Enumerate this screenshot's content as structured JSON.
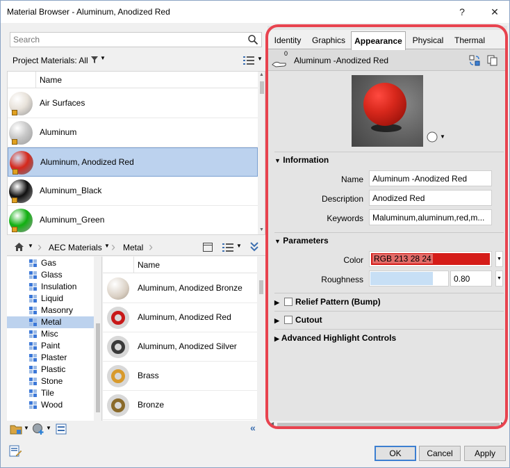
{
  "window": {
    "title": "Material Browser - Aluminum, Anodized Red",
    "help_label": "?",
    "close_label": "✕"
  },
  "search": {
    "placeholder": "Search"
  },
  "filter": {
    "label": "Project Materials: All"
  },
  "project_list": {
    "column_header": "Name",
    "items": [
      {
        "name": "Air Surfaces",
        "color": "#e8e2da"
      },
      {
        "name": "Aluminum",
        "color": "#c8c8c8"
      },
      {
        "name": "Aluminum, Anodized Red",
        "color": "#d5281c",
        "selected": true
      },
      {
        "name": "Aluminum_Black",
        "color": "#101010"
      },
      {
        "name": "Aluminum_Green",
        "color": "#10b010"
      }
    ]
  },
  "breadcrumb": {
    "library": "AEC Materials",
    "category": "Metal"
  },
  "categories": [
    "Gas",
    "Glass",
    "Insulation",
    "Liquid",
    "Masonry",
    "Metal",
    "Misc",
    "Paint",
    "Plaster",
    "Plastic",
    "Stone",
    "Tile",
    "Wood"
  ],
  "selected_category": "Metal",
  "library_list": {
    "column_header": "Name",
    "items": [
      {
        "name": "Aluminum, Anodized Bronze",
        "color": "#d9cfc3"
      },
      {
        "name": "Aluminum, Anodized Red",
        "color": "#c81818"
      },
      {
        "name": "Aluminum, Anodized Silver",
        "color": "#3a3a3a"
      },
      {
        "name": "Brass",
        "color": "#d89a2c"
      },
      {
        "name": "Bronze",
        "color": "#8a6a2a"
      }
    ]
  },
  "tabs": [
    "Identity",
    "Graphics",
    "Appearance",
    "Physical",
    "Thermal"
  ],
  "active_tab": "Appearance",
  "asset": {
    "name": "Aluminum -Anodized Red",
    "usage_count": "0"
  },
  "information": {
    "header": "Information",
    "name_label": "Name",
    "name_value": "Aluminum -Anodized Red",
    "description_label": "Description",
    "description_value": "Anodized Red",
    "keywords_label": "Keywords",
    "keywords_value": "Maluminum,aluminum,red,m..."
  },
  "parameters": {
    "header": "Parameters",
    "color_label": "Color",
    "color_value": "RGB 213 28 24",
    "color_hex": "#d51c18",
    "roughness_label": "Roughness",
    "roughness_value": "0.80",
    "roughness_fraction": 0.8
  },
  "sections": {
    "relief": "Relief Pattern (Bump)",
    "cutout": "Cutout",
    "highlight": "Advanced Highlight Controls"
  },
  "buttons": {
    "ok": "OK",
    "cancel": "Cancel",
    "apply": "Apply"
  },
  "accent": "#e8434f"
}
